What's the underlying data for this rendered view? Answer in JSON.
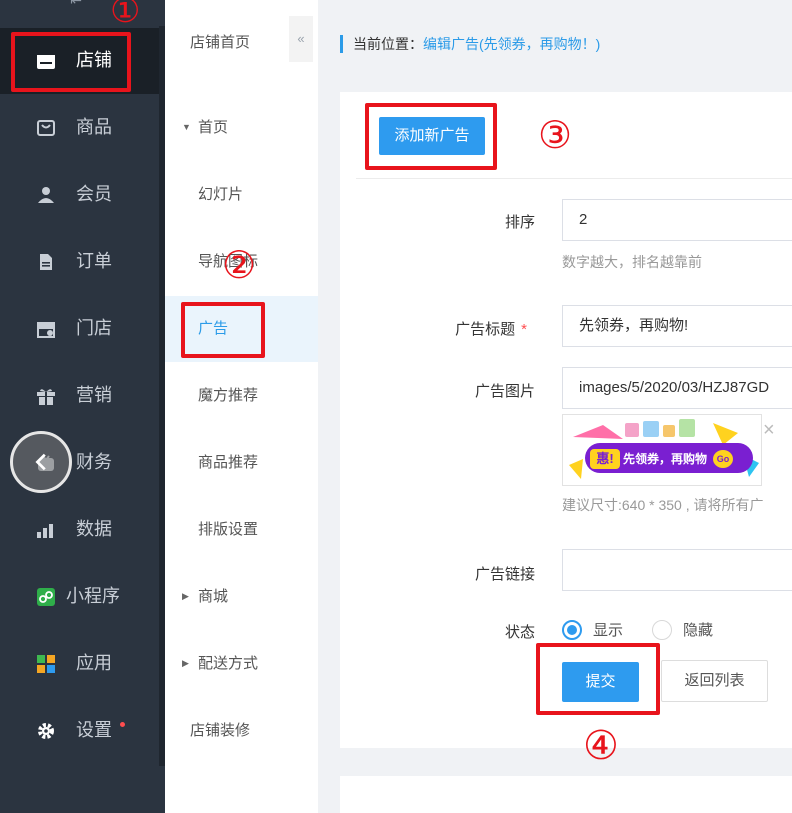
{
  "sidebar": {
    "items": [
      {
        "label": "店铺",
        "icon": "shop-icon"
      },
      {
        "label": "商品",
        "icon": "goods-icon"
      },
      {
        "label": "会员",
        "icon": "user-icon"
      },
      {
        "label": "订单",
        "icon": "order-icon"
      },
      {
        "label": "门店",
        "icon": "store-icon"
      },
      {
        "label": "营销",
        "icon": "gift-icon"
      },
      {
        "label": "财务",
        "icon": "finance-icon"
      },
      {
        "label": "数据",
        "icon": "chart-icon"
      },
      {
        "label": "小程序",
        "icon": "miniprogram-icon"
      },
      {
        "label": "应用",
        "icon": "apps-icon"
      },
      {
        "label": "设置",
        "icon": "gear-icon"
      }
    ],
    "active_index": 0
  },
  "subnav": {
    "items": [
      {
        "label": "店铺首页"
      },
      {
        "label": "首页"
      },
      {
        "label": "幻灯片"
      },
      {
        "label": "导航图标"
      },
      {
        "label": "广告"
      },
      {
        "label": "魔方推荐"
      },
      {
        "label": "商品推荐"
      },
      {
        "label": "排版设置"
      },
      {
        "label": "商城"
      },
      {
        "label": "配送方式"
      },
      {
        "label": "店铺装修"
      }
    ],
    "active_index": 4
  },
  "breadcrumb": {
    "prefix": "当前位置：",
    "current": "编辑广告(先领券，再购物！)"
  },
  "toolbar": {
    "add_label": "添加新广告"
  },
  "form": {
    "sort_label": "排序",
    "sort_value": "2",
    "sort_hint": "数字越大，排名越靠前",
    "title_label": "广告标题",
    "title_required": "*",
    "title_value": "先领券，再购物!",
    "image_label": "广告图片",
    "image_value": "images/5/2020/03/HZJ87GD",
    "image_remove": "×",
    "image_hint": "建议尺寸:640 * 350 , 请将所有广",
    "link_label": "广告链接",
    "link_value": "",
    "status_label": "状态",
    "status_options": [
      {
        "label": "显示",
        "checked": true
      },
      {
        "label": "隐藏",
        "checked": false
      }
    ],
    "submit_label": "提交",
    "back_label": "返回列表"
  },
  "ad_banner": {
    "badge": "惠!",
    "text": "先领券，再购物",
    "go": "Go"
  },
  "annotations": [
    "①",
    "②",
    "③",
    "④"
  ],
  "colors": {
    "accent": "#2e9bef",
    "sidebar_bg": "#2b3440",
    "annotation_red": "#e8141c",
    "banner_purple": "#7a1fd1",
    "banner_yellow": "#ffd21f"
  }
}
